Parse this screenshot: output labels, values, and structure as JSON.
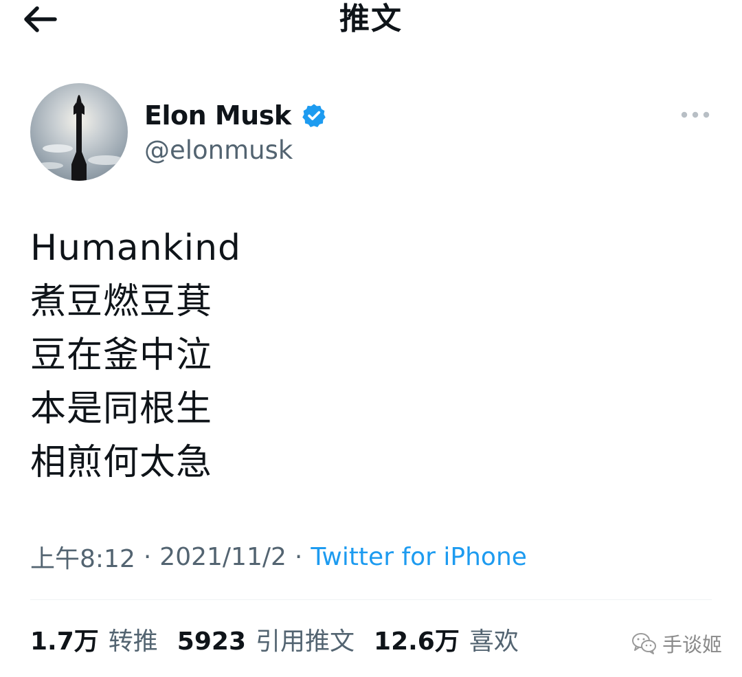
{
  "header": {
    "title": "推文",
    "back_icon": "arrow-left-icon"
  },
  "author": {
    "name": "Elon Musk",
    "handle": "@elonmusk",
    "verified": true,
    "verified_color": "#1d9bf0",
    "avatar_icon": "avatar-rocket-image",
    "more_icon": "more-dots-icon"
  },
  "tweet": {
    "lines": [
      "Humankind",
      "煮豆燃豆萁",
      "豆在釜中泣",
      "本是同根生",
      "相煎何太急"
    ]
  },
  "meta": {
    "time": "上午8:12",
    "separator": "·",
    "date": "2021/11/2",
    "source": "Twitter for iPhone",
    "source_color": "#1d9bf0"
  },
  "stats": {
    "retweets_count": "1.7万",
    "retweets_label": "转推",
    "quotes_count": "5923",
    "quotes_label": "引用推文",
    "likes_count": "12.6万",
    "likes_label": "喜欢"
  },
  "watermark": {
    "text": "手谈姬",
    "icon": "wechat-icon"
  }
}
